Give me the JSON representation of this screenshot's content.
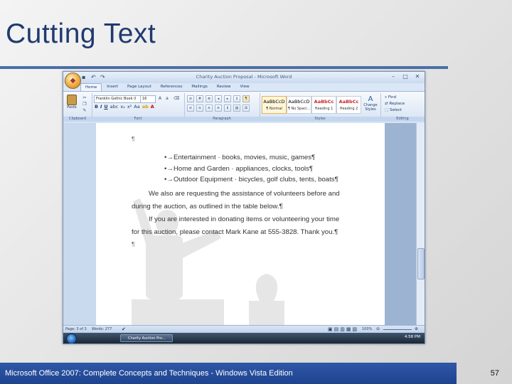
{
  "slide": {
    "title": "Cutting Text",
    "footer": "Microsoft Office 2007: Complete Concepts and Techniques - Windows Vista Edition",
    "page_number": "57"
  },
  "window": {
    "title": "Charity Auction Proposal - Microsoft Word"
  },
  "ribbon": {
    "tabs": [
      "Home",
      "Insert",
      "Page Layout",
      "References",
      "Mailings",
      "Review",
      "View"
    ],
    "active_tab": "Home",
    "font_name": "Franklin Gothic Book (I",
    "font_size": "16",
    "paste_label": "Paste",
    "groups": {
      "clipboard": "Clipboard",
      "font": "Font",
      "paragraph": "Paragraph",
      "styles": "Styles",
      "editing": "Editing"
    },
    "styles": [
      {
        "sample": "AaBbCcD",
        "name": "¶ Normal"
      },
      {
        "sample": "AaBbCcD",
        "name": "¶ No Spaci..."
      },
      {
        "sample": "AaBbCc",
        "name": "Heading 1"
      },
      {
        "sample": "AaBbCc",
        "name": "Heading 2"
      }
    ],
    "change_styles": "Change Styles",
    "editing": [
      "Find",
      "Replace",
      "Select"
    ]
  },
  "document": {
    "lines": [
      "•→Entertainment · books, movies, music, games¶",
      "•→Home and Garden · appliances, clocks, tools¶",
      "•→Outdoor Equipment · bicycles, golf clubs, tents, boats¶",
      "We also are requesting the assistance of volunteers before and",
      "during the auction, as outlined in the table below.¶",
      "If you are interested in donating items or volunteering your time",
      "for this auction, please contact Mark Kane at 555-3828.  Thank you.¶"
    ],
    "pilcrow": "¶"
  },
  "status": {
    "page": "Page: 3 of 3",
    "words": "Words: 277",
    "zoom": "100%"
  },
  "taskbar": {
    "button": "Charity Auction Pro...",
    "clock": "4:58 PM"
  }
}
